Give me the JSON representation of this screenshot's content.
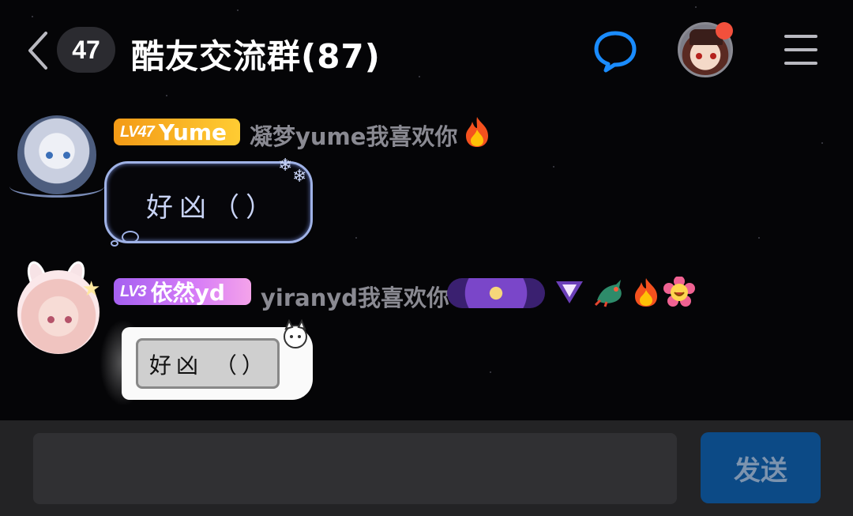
{
  "header": {
    "unread_count": "47",
    "title": "酷友交流群(87)",
    "icons": {
      "back": "chevron-left-icon",
      "chat": "chat-bubble-icon",
      "menu": "hamburger-menu-icon"
    },
    "has_notification_dot": true
  },
  "messages": [
    {
      "level_tag": "LV47",
      "level_name": "Yume",
      "sender": "凝梦yume我喜欢你",
      "emblems": [
        "fire-emblem"
      ],
      "text": "好凶（）",
      "badge_color": "#f39a16"
    },
    {
      "level_tag": "LV3",
      "level_name": "依然yd",
      "sender": "yiranyd我喜欢你",
      "emblems": [
        "galaxy-emblem",
        "triangle-gem-emblem",
        "dragon-emblem",
        "fire-emblem",
        "flower-emoji-emblem"
      ],
      "text": "好凶 （）",
      "badge_color": "#a560f0"
    }
  ],
  "composer": {
    "input_value": "",
    "input_placeholder": "",
    "send_label": "发送"
  },
  "colors": {
    "accent_blue": "#1a8cff",
    "send_bg": "#0c4a86",
    "notification": "#f2503c"
  }
}
